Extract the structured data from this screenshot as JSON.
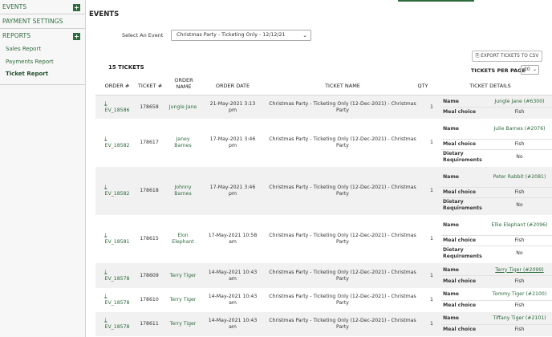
{
  "sidebar": {
    "events_label": "EVENTS",
    "payment_settings_label": "PAYMENT SETTINGS",
    "reports_label": "REPORTS",
    "plus_symbol": "+",
    "report_links": [
      "Sales Report",
      "Payments Report",
      "Ticket Report"
    ],
    "active_link": "Ticket Report"
  },
  "page": {
    "title": "EVENTS",
    "select_label": "Select An Event",
    "selected_event": "Christmas Party - Ticketing Only - 12/12/21",
    "export_label": "EXPORT TICKETS TO CSV",
    "tickets_count": "15 TICKETS",
    "per_page_label": "TICKETS PER PAGE",
    "per_page_value": "20"
  },
  "table": {
    "headers": {
      "order": "ORDER #",
      "ticket": "TICKET #",
      "order_name": "ORDER NAME",
      "order_date": "ORDER DATE",
      "ticket_name": "TICKET NAME",
      "qty": "QTY",
      "details": "TICKET DETAILS"
    },
    "rows": [
      {
        "order": "EV_18586",
        "ticket": "178658",
        "order_name": "Jungle Jane",
        "order_date": "21-May-2021 3:13 pm",
        "ticket_name": "Christmas Party - Ticketing Only (12-Dec-2021) - Christmas Party",
        "qty": "1",
        "details": [
          {
            "key": "Name",
            "value": "Jungle Jane (#6300)",
            "link": true
          },
          {
            "key": "Meal choice",
            "value": "Fish"
          }
        ]
      },
      {
        "order": "EV_18582",
        "ticket": "178617",
        "order_name": "Janey Barnes",
        "order_date": "17-May-2021 3:46 pm",
        "ticket_name": "Christmas Party - Ticketing Only (12-Dec-2021) - Christmas Party",
        "qty": "1",
        "details": [
          {
            "key": "Name",
            "value": "Julie Barnes (#2076)",
            "link": true
          },
          {
            "key": "Meal choice",
            "value": "Fish"
          },
          {
            "key": "Dietary Requirements",
            "value": "No"
          }
        ]
      },
      {
        "order": "EV_18582",
        "ticket": "178618",
        "order_name": "Johnny Barnes",
        "order_date": "17-May-2021 3:46 pm",
        "ticket_name": "Christmas Party - Ticketing Only (12-Dec-2021) - Christmas Party",
        "qty": "1",
        "details": [
          {
            "key": "Name",
            "value": "Peter Rabbit (#2081)",
            "link": true
          },
          {
            "key": "Meal choice",
            "value": "Fish"
          },
          {
            "key": "Dietary Requirements",
            "value": "No"
          }
        ]
      },
      {
        "order": "EV_18581",
        "ticket": "178615",
        "order_name": "Elon Elephant",
        "order_date": "17-May-2021 10:58 am",
        "ticket_name": "Christmas Party - Ticketing Only (12-Dec-2021) - Christmas Party",
        "qty": "1",
        "details": [
          {
            "key": "Name",
            "value": "Ellie Elephant (#2096)",
            "link": true
          },
          {
            "key": "Meal choice",
            "value": "Fish"
          },
          {
            "key": "Dietary Requirements",
            "value": "No"
          }
        ]
      },
      {
        "order": "EV_18578",
        "ticket": "178609",
        "order_name": "Terry Tiger",
        "order_date": "14-May-2021 10:43 am",
        "ticket_name": "Christmas Party - Ticketing Only (12-Dec-2021) - Christmas Party",
        "qty": "1",
        "details": [
          {
            "key": "Name",
            "value": "Terry Tiger (#2099)",
            "link": true,
            "underline": true
          },
          {
            "key": "Meal choice",
            "value": "Fish"
          }
        ]
      },
      {
        "order": "EV_18578",
        "ticket": "178610",
        "order_name": "Terry Tiger",
        "order_date": "14-May-2021 10:43 am",
        "ticket_name": "Christmas Party - Ticketing Only (12-Dec-2021) - Christmas Party",
        "qty": "1",
        "details": [
          {
            "key": "Name",
            "value": "Tommy Tiger (#2100)",
            "link": true
          },
          {
            "key": "Meal choice",
            "value": "Fish"
          }
        ]
      },
      {
        "order": "EV_18578",
        "ticket": "178611",
        "order_name": "Terry Tiger",
        "order_date": "14-May-2021 10:43 am",
        "ticket_name": "Christmas Party - Ticketing Only (12-Dec-2021) - Christmas Party",
        "qty": "1",
        "details": [
          {
            "key": "Name",
            "value": "Tiffany Tiger (#2101)",
            "link": true
          },
          {
            "key": "Meal choice",
            "value": "Fish"
          }
        ]
      }
    ]
  },
  "icons": {
    "download": "download-icon",
    "export": "export-icon",
    "chevron": "chevron-down-icon",
    "plus": "plus-icon"
  },
  "colors": {
    "accent": "#2e6b3c",
    "row_alt": "#f1f1f1"
  }
}
